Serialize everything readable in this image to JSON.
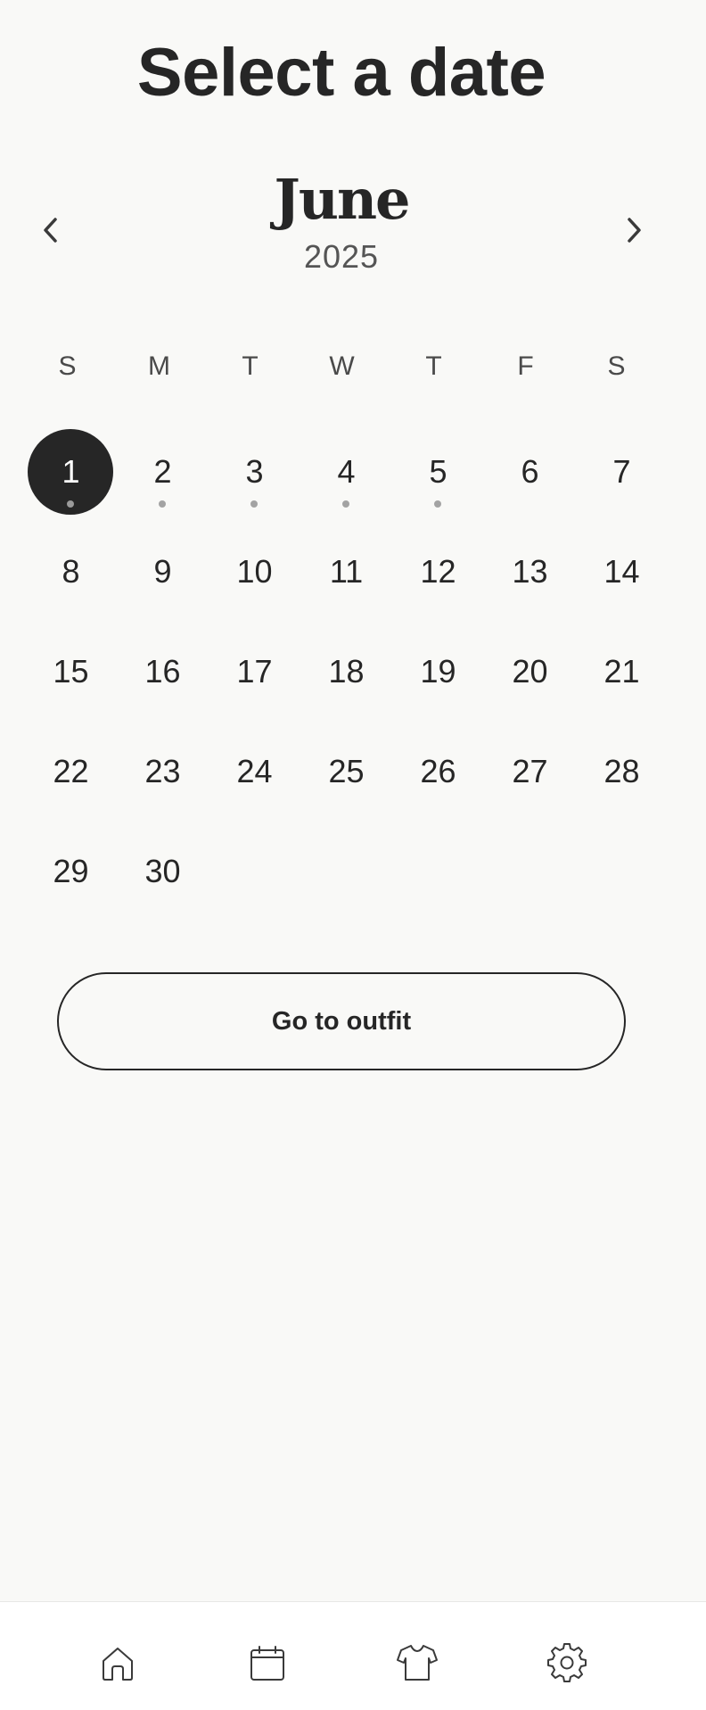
{
  "header": {
    "title": "Select a date"
  },
  "calendar": {
    "month": "June",
    "year": "2025",
    "prev_icon": "chevron-left-icon",
    "next_icon": "chevron-right-icon",
    "weekdays": [
      "S",
      "M",
      "T",
      "W",
      "T",
      "F",
      "S"
    ],
    "first_weekday_index": 0,
    "selected_day": 1,
    "days_with_events": [
      1,
      2,
      3,
      4,
      5
    ],
    "days": [
      "1",
      "2",
      "3",
      "4",
      "5",
      "6",
      "7",
      "8",
      "9",
      "10",
      "11",
      "12",
      "13",
      "14",
      "15",
      "16",
      "17",
      "18",
      "19",
      "20",
      "21",
      "22",
      "23",
      "24",
      "25",
      "26",
      "27",
      "28",
      "29",
      "30"
    ]
  },
  "actions": {
    "go_to_outfit_label": "Go to outfit"
  },
  "tabbar": {
    "items": [
      {
        "name": "home",
        "icon": "home-icon"
      },
      {
        "name": "calendar",
        "icon": "calendar-icon"
      },
      {
        "name": "wardrobe",
        "icon": "shirt-icon"
      },
      {
        "name": "settings",
        "icon": "gear-icon"
      }
    ]
  },
  "colors": {
    "background": "#f9f9f7",
    "primary": "#262626",
    "muted_dot": "#a3a3a3",
    "tabbar_background": "#ffffff"
  }
}
